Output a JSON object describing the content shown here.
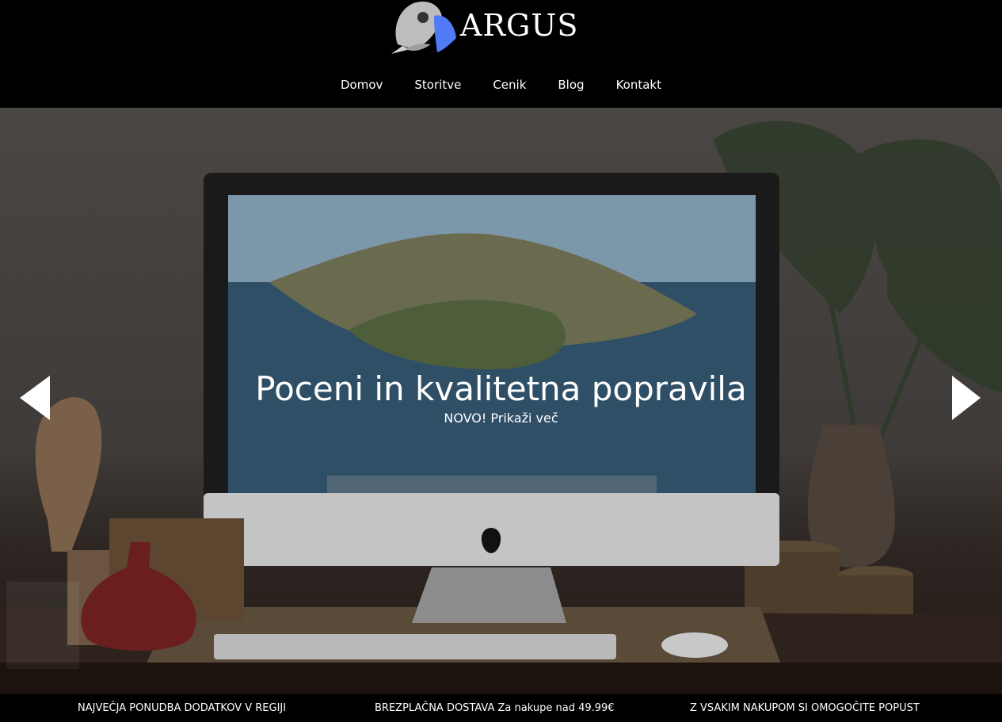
{
  "brand": {
    "name": "ARGUS"
  },
  "nav": {
    "items": [
      "Domov",
      "Storitve",
      "Cenik",
      "Blog",
      "Kontakt"
    ]
  },
  "hero": {
    "title": "Poceni in kvalitetna popravila",
    "subtitle": "NOVO! Prikaži več",
    "prev_icon": "chevron-left-icon",
    "next_icon": "chevron-right-icon"
  },
  "infobar": {
    "item1": "NAJVEČJA PONUDBA DODATKOV V REGIJI",
    "item2_strong": "BREZPLAČNA DOSTAVA",
    "item2_rest": " Za nakupe nad 49.99€",
    "item3": "Z VSAKIM NAKUPOM SI OMOGOČITE POPUST"
  },
  "colors": {
    "header_bg": "#000000",
    "accent_blue": "#4f7cf6",
    "text": "#ffffff"
  }
}
